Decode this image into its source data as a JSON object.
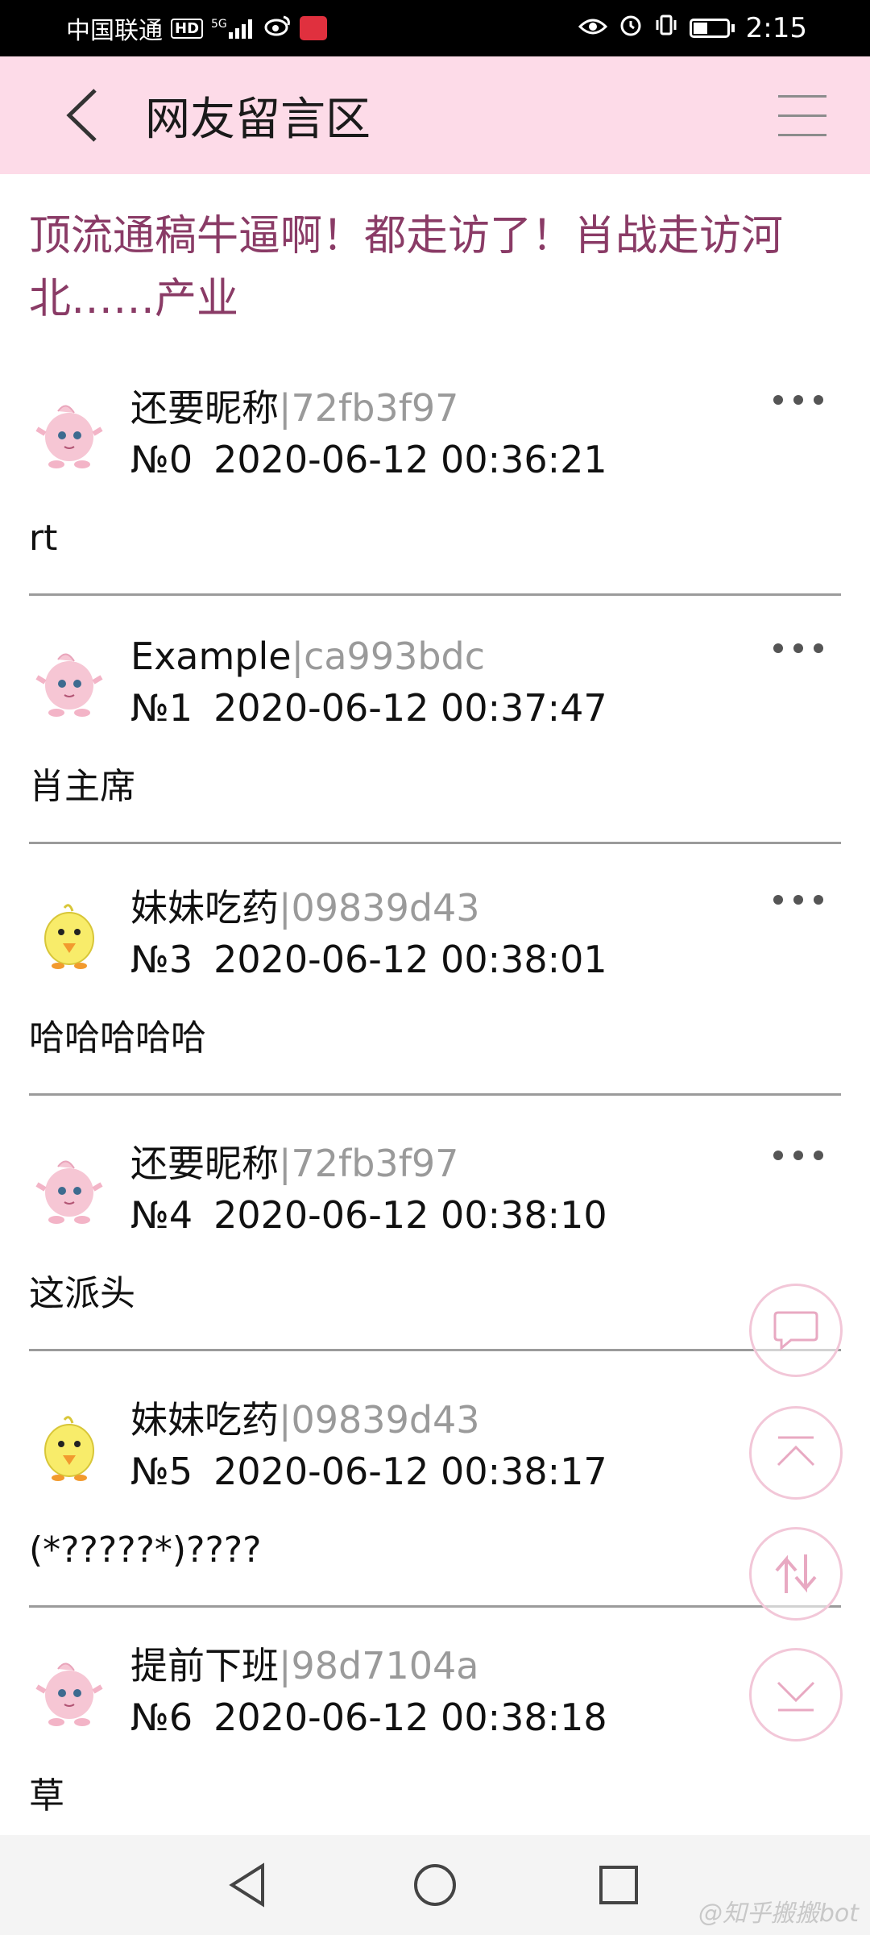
{
  "status_bar": {
    "carrier": "中国联通",
    "hd_badge": "HD",
    "network": "5G",
    "time": "2:15"
  },
  "header": {
    "title": "网友留言区",
    "back_icon": "chevron-left-icon",
    "menu_icon": "hamburger-menu-icon"
  },
  "topic": {
    "title": "顶流通稿牛逼啊！都走访了！肖战走访河北……产业"
  },
  "posts": [
    {
      "name": "还要昵称",
      "uid": "|72fb3f97",
      "no": "№0",
      "time": "2020-06-12 00:36:21",
      "content": "rt",
      "avatar": "pink-jigglypuff-avatar"
    },
    {
      "name": "Example",
      "uid": "|ca993bdc",
      "no": "№1",
      "time": "2020-06-12 00:37:47",
      "content": "肖主席",
      "avatar": "pink-jigglypuff-avatar"
    },
    {
      "name": "妹妹吃药",
      "uid": "|09839d43",
      "no": "№3",
      "time": "2020-06-12 00:38:01",
      "content": "哈哈哈哈哈",
      "avatar": "yellow-chick-avatar"
    },
    {
      "name": "还要昵称",
      "uid": "|72fb3f97",
      "no": "№4",
      "time": "2020-06-12 00:38:10",
      "content": "这派头",
      "avatar": "pink-jigglypuff-avatar"
    },
    {
      "name": "妹妹吃药",
      "uid": "|09839d43",
      "no": "№5",
      "time": "2020-06-12 00:38:17",
      "content": "(*?????*)????",
      "avatar": "yellow-chick-avatar"
    },
    {
      "name": "提前下班",
      "uid": "|98d7104a",
      "no": "№6",
      "time": "2020-06-12 00:38:18",
      "content": "草",
      "avatar": "pink-jigglypuff-avatar"
    }
  ],
  "fabs": [
    "comment-icon",
    "scroll-top-icon",
    "refresh-swap-icon",
    "scroll-bottom-icon"
  ],
  "navbar": {
    "back": "triangle-back-icon",
    "home": "circle-home-icon",
    "recent": "square-recent-icon"
  },
  "watermark": "@知乎搬搬bot",
  "colors": {
    "header_bg": "#fddbe8",
    "topic_title": "#8a3b66",
    "uid_gray": "#9a9a9a",
    "fab_border": "#f2c7d8"
  }
}
